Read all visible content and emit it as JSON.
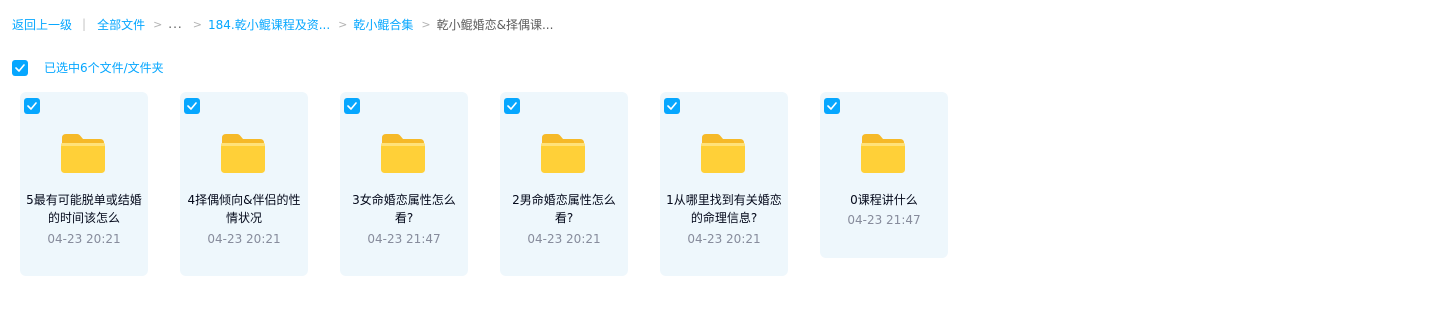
{
  "breadcrumb": {
    "back_label": "返回上一级",
    "separator_bar": "|",
    "root_label": "全部文件",
    "sep": ">",
    "ellipsis": "...",
    "items": [
      {
        "label": "184.乾小鲲课程及资..."
      },
      {
        "label": "乾小鲲合集"
      }
    ],
    "current_label": "乾小鲲婚恋&择偶课..."
  },
  "selection": {
    "label": "已选中6个文件/文件夹",
    "checked": true
  },
  "colors": {
    "accent": "#06a7ff",
    "card_bg": "#eef7fc",
    "folder_yellow": "#ffd038",
    "time_gray": "#878c9c"
  },
  "files": [
    {
      "name": "5最有可能脱单或结婚的时间该怎么",
      "time": "04-23 20:21",
      "icon": "folder-icon",
      "checked": true
    },
    {
      "name": "4择偶倾向&伴侣的性情状况",
      "time": "04-23 20:21",
      "icon": "folder-icon",
      "checked": true
    },
    {
      "name": "3女命婚恋属性怎么看?",
      "time": "04-23 21:47",
      "icon": "folder-icon",
      "checked": true
    },
    {
      "name": "2男命婚恋属性怎么看?",
      "time": "04-23 20:21",
      "icon": "folder-icon",
      "checked": true
    },
    {
      "name": "1从哪里找到有关婚恋的命理信息?",
      "time": "04-23 20:21",
      "icon": "folder-icon",
      "checked": true
    },
    {
      "name": "0课程讲什么",
      "time": "04-23 21:47",
      "icon": "folder-icon",
      "checked": true
    }
  ]
}
